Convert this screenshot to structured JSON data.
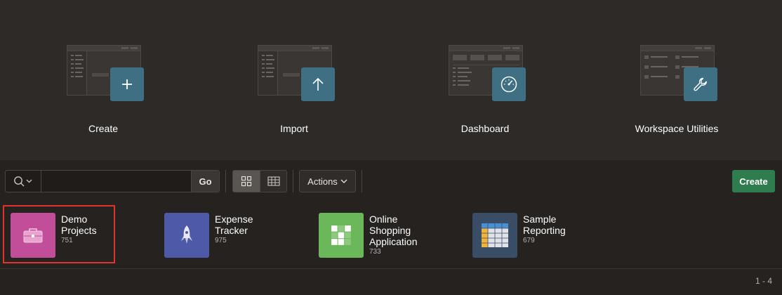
{
  "launchers": [
    {
      "label": "Create",
      "icon": "plus-icon"
    },
    {
      "label": "Import",
      "icon": "upload-arrow-icon"
    },
    {
      "label": "Dashboard",
      "icon": "speedometer-icon"
    },
    {
      "label": "Workspace Utilities",
      "icon": "wrench-icon"
    }
  ],
  "toolbar": {
    "search_value": "",
    "go_label": "Go",
    "actions_label": "Actions",
    "create_label": "Create",
    "view_mode": "icons"
  },
  "apps": [
    {
      "name_line1": "Demo",
      "name_line2": "Projects",
      "name_line3": "",
      "id": "751",
      "color": "#c24e9a",
      "icon": "briefcase-icon"
    },
    {
      "name_line1": "Expense",
      "name_line2": "Tracker",
      "name_line3": "",
      "id": "975",
      "color": "#4e59a8",
      "icon": "rocket-icon"
    },
    {
      "name_line1": "Online",
      "name_line2": "Shopping",
      "name_line3": "Application",
      "id": "733",
      "color": "#6bb85a",
      "icon": "grid-icon"
    },
    {
      "name_line1": "Sample",
      "name_line2": "Reporting",
      "name_line3": "",
      "id": "679",
      "color": "#3a4d66",
      "icon": "spreadsheet-icon"
    }
  ],
  "pagination": "1 - 4",
  "colors": {
    "tile": "#3f6f82",
    "create_button": "#2f7d4f",
    "highlight": "#e2332a"
  }
}
